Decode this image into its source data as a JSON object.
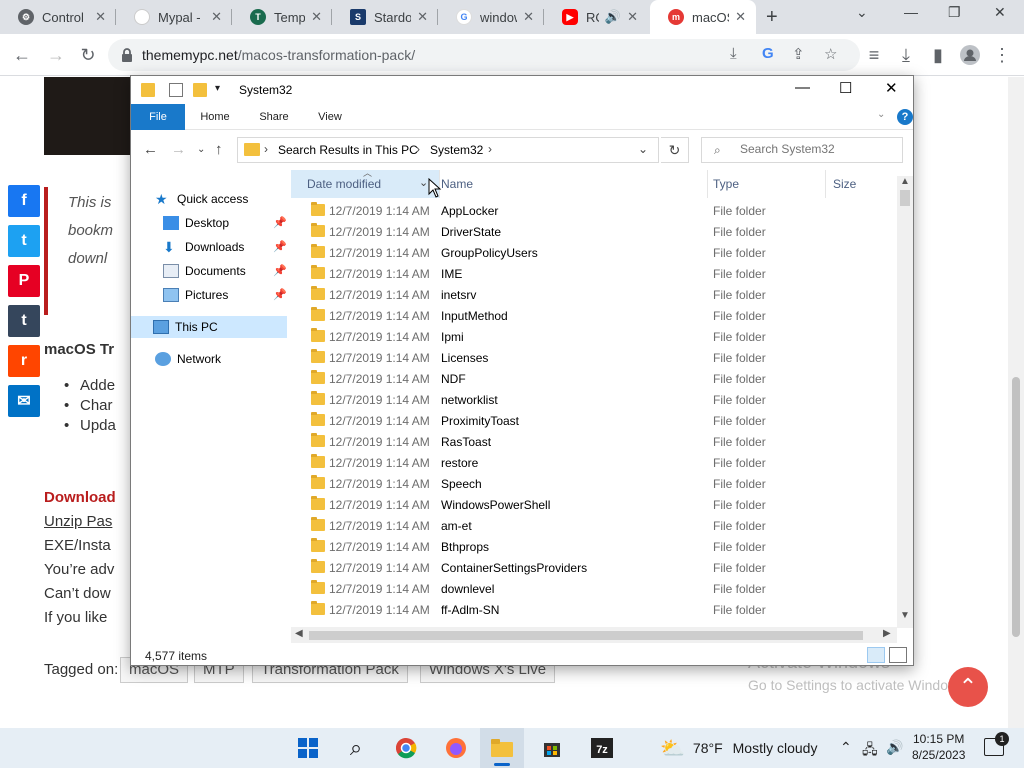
{
  "browser": {
    "tabs": [
      {
        "title": "Control",
        "color": "#5f6368",
        "glyph": "⚙"
      },
      {
        "title": "Mypal -",
        "color": "#ffffff",
        "glyph": ""
      },
      {
        "title": "Temp M",
        "color": "#1a6b4e",
        "glyph": "T"
      },
      {
        "title": "Stardoc",
        "color": "#1a3a6b",
        "glyph": "S"
      },
      {
        "title": "window",
        "color": "#ffffff",
        "glyph": "G"
      },
      {
        "title": "ROI",
        "color": "#ff0000",
        "glyph": "▶"
      },
      {
        "title": "macOS",
        "color": "#e53935",
        "glyph": "m"
      }
    ],
    "url_host": "thememypc.net",
    "url_path": "/macos-transformation-pack/"
  },
  "webpage": {
    "quote_lines": [
      "This is",
      "bookm",
      "downl"
    ],
    "heading": "macOS Tr",
    "bullets": [
      "Adde",
      "Char",
      "Upda"
    ],
    "download": "Download",
    "unzip": "Unzip Pas",
    "lines": [
      "EXE/Insta",
      "You’re adv",
      "Can’t dow",
      "If you like"
    ],
    "tagged_label": "Tagged on:",
    "tags": [
      "macOS",
      "MTP",
      "Transformation Pack",
      "Windows X's Live"
    ],
    "activate_title": "Activate Windows",
    "activate_sub": "Go to Settings to activate Windows."
  },
  "explorer": {
    "title": "System32",
    "ribbon_tabs": [
      "File",
      "Home",
      "Share",
      "View"
    ],
    "breadcrumb": [
      "Search Results in This PC",
      "System32"
    ],
    "search_placeholder": "Search System32",
    "nav": {
      "quick_access": "Quick access",
      "pinned": [
        "Desktop",
        "Downloads",
        "Documents",
        "Pictures"
      ],
      "this_pc": "This PC",
      "network": "Network"
    },
    "columns": {
      "date": "Date modified",
      "name": "Name",
      "type": "Type",
      "size": "Size"
    },
    "files": [
      {
        "date": "12/7/2019 1:14 AM",
        "name": "AppLocker",
        "type": "File folder"
      },
      {
        "date": "12/7/2019 1:14 AM",
        "name": "DriverState",
        "type": "File folder"
      },
      {
        "date": "12/7/2019 1:14 AM",
        "name": "GroupPolicyUsers",
        "type": "File folder"
      },
      {
        "date": "12/7/2019 1:14 AM",
        "name": "IME",
        "type": "File folder"
      },
      {
        "date": "12/7/2019 1:14 AM",
        "name": "inetsrv",
        "type": "File folder"
      },
      {
        "date": "12/7/2019 1:14 AM",
        "name": "InputMethod",
        "type": "File folder"
      },
      {
        "date": "12/7/2019 1:14 AM",
        "name": "Ipmi",
        "type": "File folder"
      },
      {
        "date": "12/7/2019 1:14 AM",
        "name": "Licenses",
        "type": "File folder"
      },
      {
        "date": "12/7/2019 1:14 AM",
        "name": "NDF",
        "type": "File folder"
      },
      {
        "date": "12/7/2019 1:14 AM",
        "name": "networklist",
        "type": "File folder"
      },
      {
        "date": "12/7/2019 1:14 AM",
        "name": "ProximityToast",
        "type": "File folder"
      },
      {
        "date": "12/7/2019 1:14 AM",
        "name": "RasToast",
        "type": "File folder"
      },
      {
        "date": "12/7/2019 1:14 AM",
        "name": "restore",
        "type": "File folder"
      },
      {
        "date": "12/7/2019 1:14 AM",
        "name": "Speech",
        "type": "File folder"
      },
      {
        "date": "12/7/2019 1:14 AM",
        "name": "WindowsPowerShell",
        "type": "File folder"
      },
      {
        "date": "12/7/2019 1:14 AM",
        "name": "am-et",
        "type": "File folder"
      },
      {
        "date": "12/7/2019 1:14 AM",
        "name": "Bthprops",
        "type": "File folder"
      },
      {
        "date": "12/7/2019 1:14 AM",
        "name": "ContainerSettingsProviders",
        "type": "File folder"
      },
      {
        "date": "12/7/2019 1:14 AM",
        "name": "downlevel",
        "type": "File folder"
      },
      {
        "date": "12/7/2019 1:14 AM",
        "name": "ff-Adlm-SN",
        "type": "File folder"
      }
    ],
    "item_count": "4,577 items"
  },
  "taskbar": {
    "temp": "78°F",
    "weather": "Mostly cloudy",
    "time": "10:15 PM",
    "date": "8/25/2023",
    "notifications": "1"
  }
}
